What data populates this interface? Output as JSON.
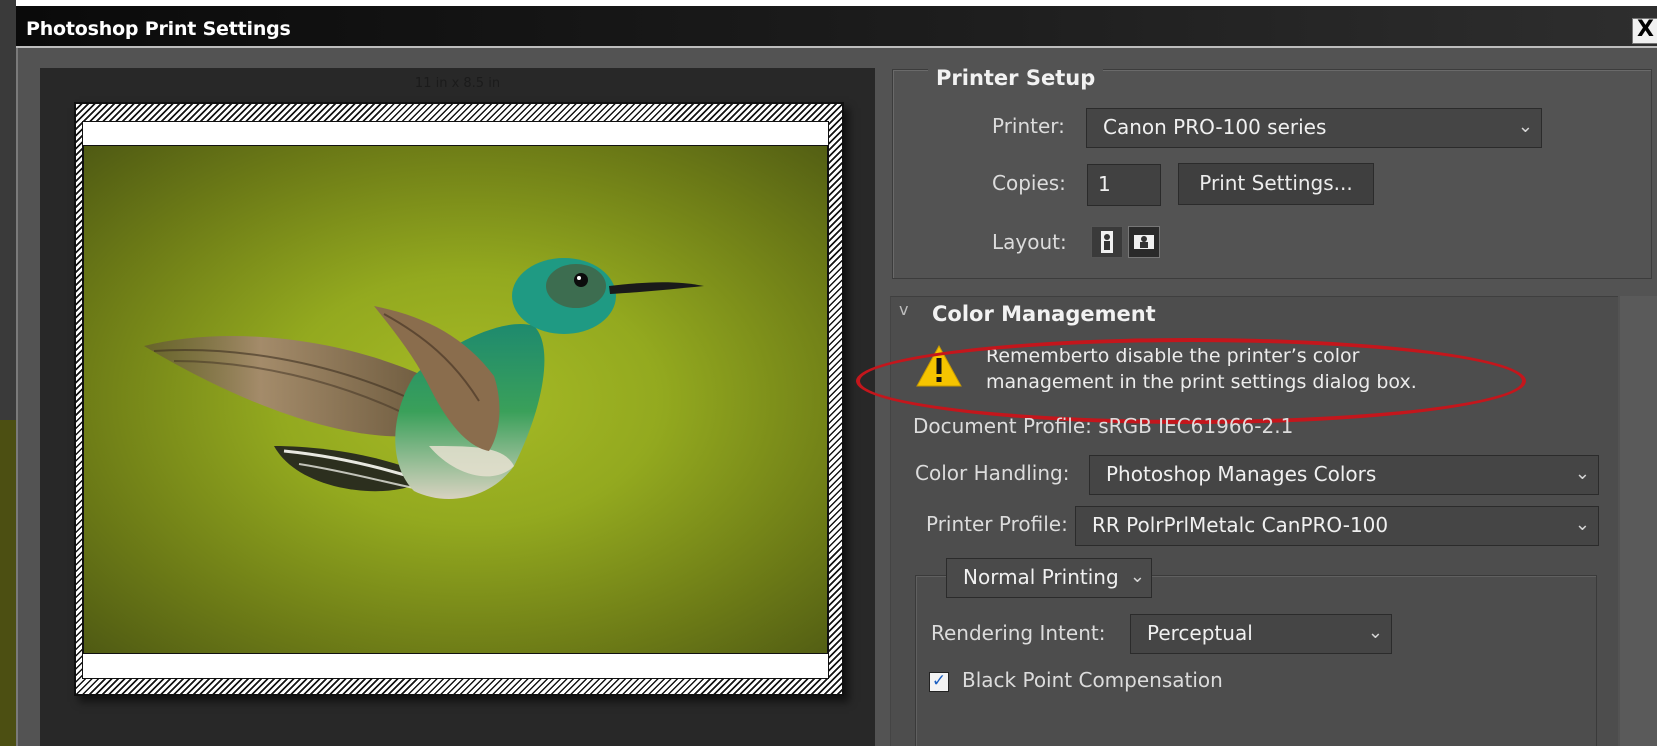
{
  "window": {
    "title": "Photoshop Print Settings",
    "close_label": "X"
  },
  "preview": {
    "paper_size": "11 in x 8.5 in"
  },
  "printer_setup": {
    "group_title": "Printer Setup",
    "printer_label": "Printer:",
    "printer_value": "Canon PRO-100 series",
    "copies_label": "Copies:",
    "copies_value": "1",
    "print_settings_button": "Print Settings...",
    "layout_label": "Layout:"
  },
  "color_management": {
    "section_title": "Color Management",
    "collapse_chevron": "v",
    "warning_line1": "Rememberto disable the printer’s color",
    "warning_line2": "management in the print settings dialog box.",
    "document_profile": "Document Profile: sRGB IEC61966-2.1",
    "color_handling_label": "Color Handling:",
    "color_handling_value": "Photoshop Manages Colors",
    "printer_profile_label": "Printer Profile:",
    "printer_profile_value": "RR PolrPrlMetalc CanPRO-100",
    "printing_mode": "Normal Printing",
    "rendering_intent_label": "Rendering Intent:",
    "rendering_intent_value": "Perceptual",
    "black_point_label": "Black Point Compensation",
    "black_point_checked": true
  },
  "colors": {
    "dialog_bg": "#535353",
    "annotation_red": "#c4161c",
    "warning_yellow": "#f5c400"
  }
}
